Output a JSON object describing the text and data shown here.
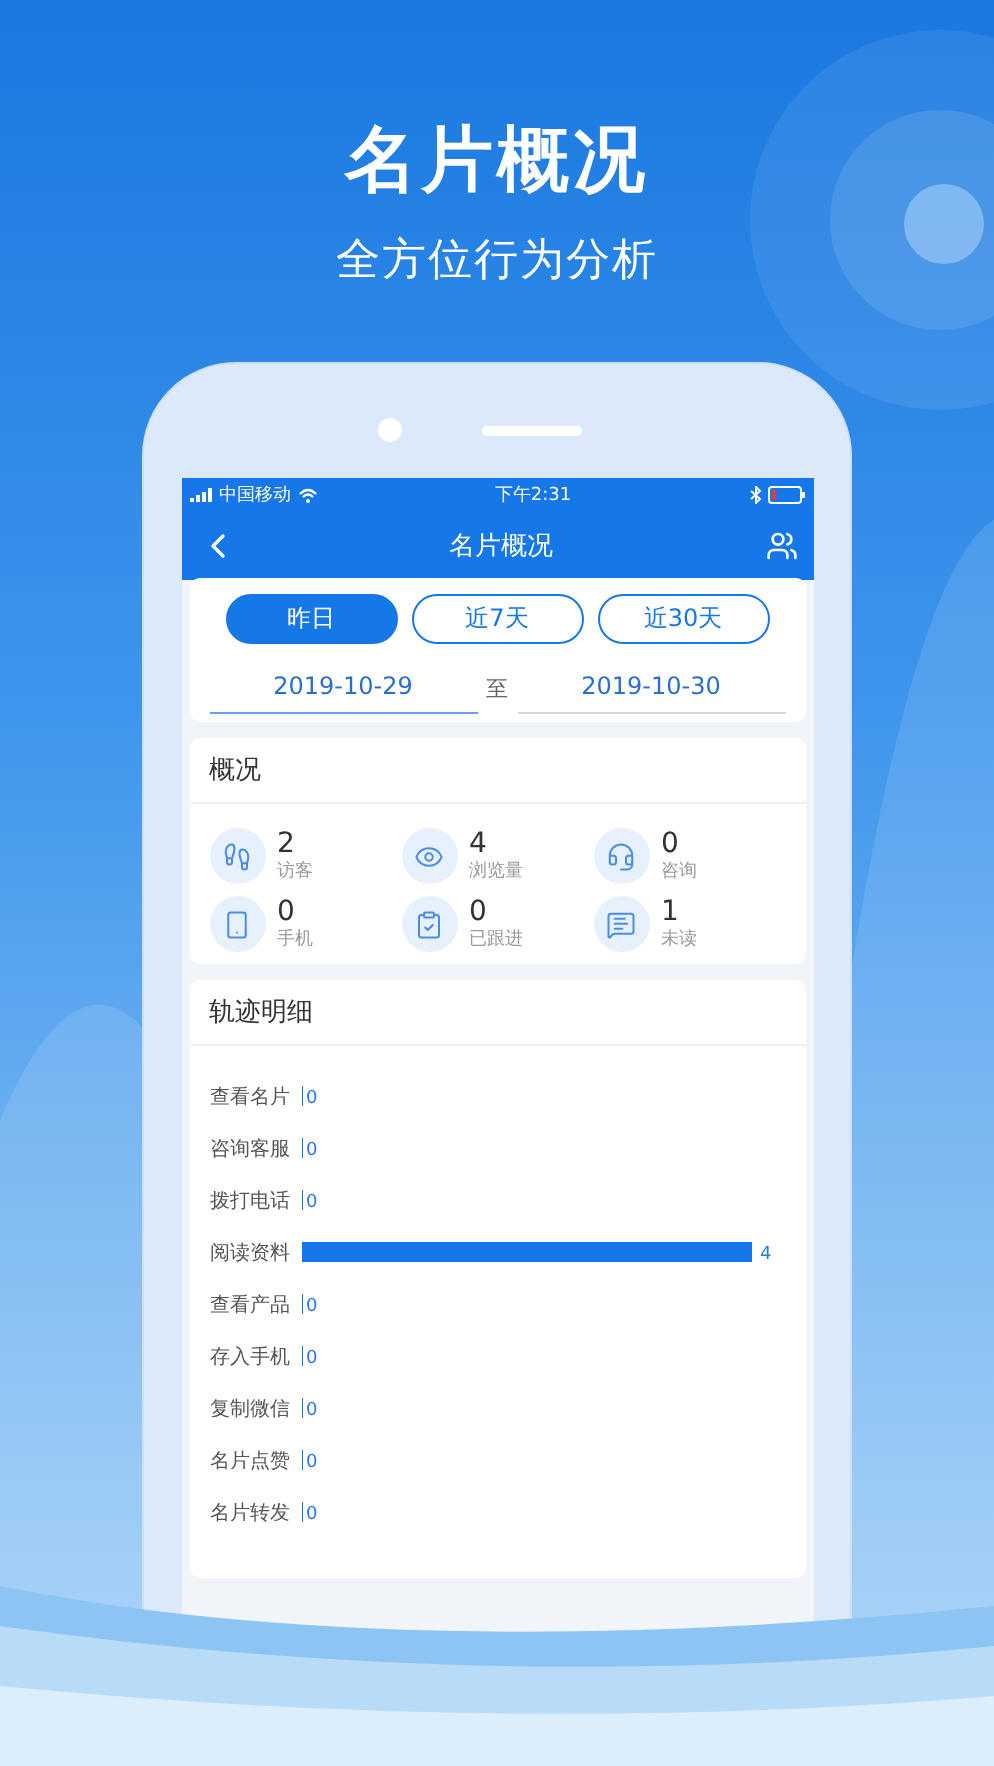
{
  "banner": {
    "title": "名片概况",
    "subtitle": "全方位行为分析"
  },
  "status_bar": {
    "carrier": "中国移动",
    "time": "下午2:31"
  },
  "nav": {
    "title": "名片概况"
  },
  "periods": [
    {
      "label": "昨日",
      "selected": true
    },
    {
      "label": "近7天",
      "selected": false
    },
    {
      "label": "近30天",
      "selected": false
    }
  ],
  "date_range": {
    "start": {
      "value": "2019-10-29",
      "active": true
    },
    "separator": "至",
    "end": {
      "value": "2019-10-30",
      "active": false
    }
  },
  "overview": {
    "title": "概况",
    "stats": [
      {
        "kind": "visitors",
        "value": "2",
        "label": "访客"
      },
      {
        "kind": "views",
        "value": "4",
        "label": "浏览量"
      },
      {
        "kind": "consult",
        "value": "0",
        "label": "咨询"
      },
      {
        "kind": "phone",
        "value": "0",
        "label": "手机"
      },
      {
        "kind": "followed",
        "value": "0",
        "label": "已跟进"
      },
      {
        "kind": "unread",
        "value": "1",
        "label": "未读"
      }
    ]
  },
  "track": {
    "title": "轨迹明细",
    "chart_data": {
      "type": "bar",
      "orientation": "horizontal",
      "value_labels": [
        "0",
        "0",
        "0",
        "4",
        "0",
        "0",
        "0",
        "0",
        "0"
      ],
      "categories": [
        "查看名片",
        "咨询客服",
        "拨打电话",
        "阅读资料",
        "查看产品",
        "存入手机",
        "复制微信",
        "名片点赞",
        "名片转发"
      ],
      "values": [
        0,
        0,
        0,
        4,
        0,
        0,
        0,
        0,
        0
      ]
    }
  }
}
